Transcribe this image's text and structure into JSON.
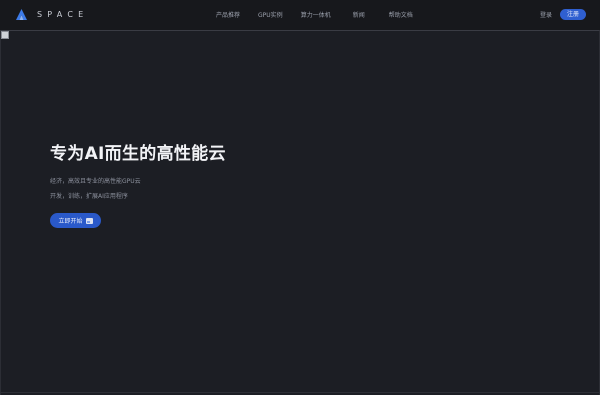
{
  "brand": {
    "name": "SPACE",
    "logo_icon": "arrow-logo-icon",
    "accent": "#2f5fd0"
  },
  "nav": {
    "items": [
      {
        "label": "产品推荐"
      },
      {
        "label": "GPU实例"
      },
      {
        "label": "算力一体机"
      },
      {
        "label": "新闻"
      },
      {
        "label": "帮助文档"
      }
    ]
  },
  "auth": {
    "login_label": "登录",
    "register_label": "注册"
  },
  "hero": {
    "title": "专为AI而生的高性能云",
    "subtitle_line1": "经济，高效且专业的高性能GPU云",
    "subtitle_line2": "开发，训练，扩展AI应用程序",
    "cta_label": "立即开始",
    "cta_icon": "broken-image-icon"
  },
  "colors": {
    "background": "#1c1e24",
    "navbar": "#17181c",
    "button": "#2a59c9"
  }
}
